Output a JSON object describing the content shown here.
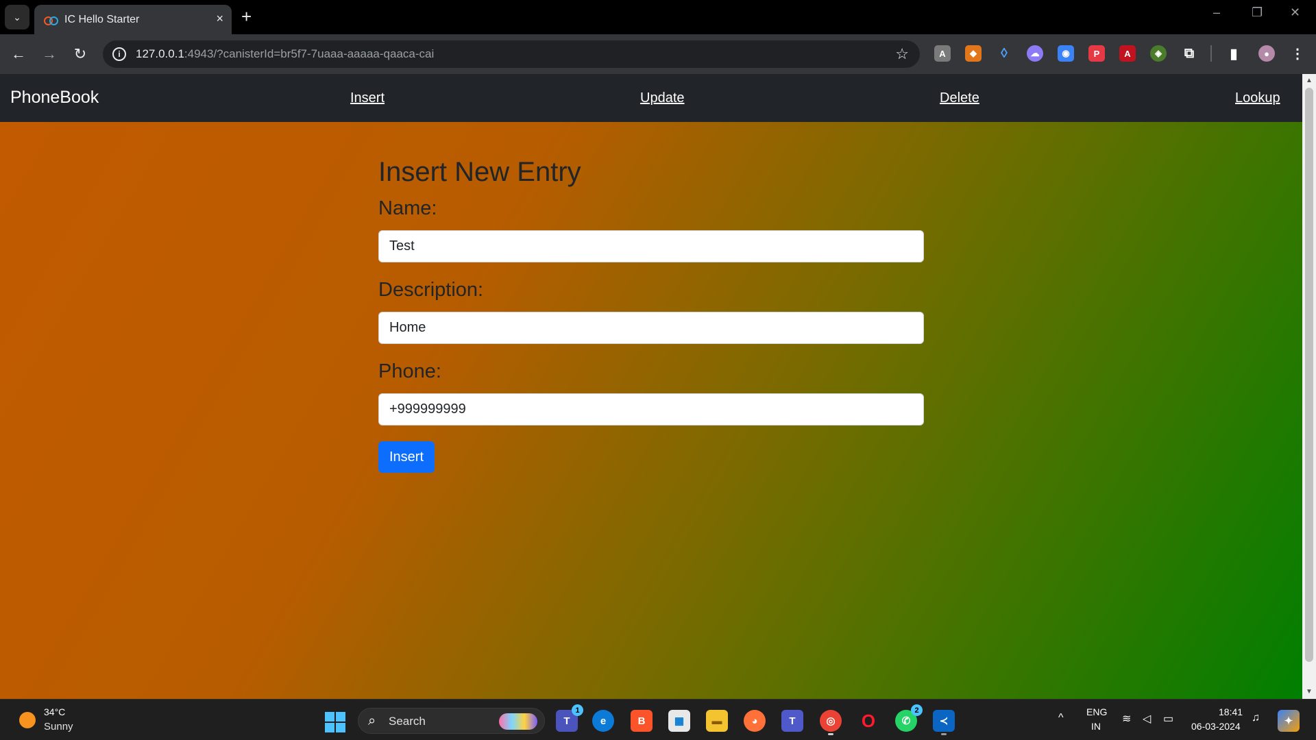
{
  "browser": {
    "tab_title": "IC Hello Starter",
    "tab_close": "×",
    "new_tab": "+",
    "url_host": "127.0.0.1",
    "url_rest": ":4943/?canisterId=br5f7-7uaaa-aaaaa-qaaca-cai",
    "window_controls": [
      "–",
      "❐",
      "✕"
    ]
  },
  "navbar": {
    "brand": "PhoneBook",
    "links": [
      "Insert",
      "Update",
      "Delete",
      "Lookup"
    ]
  },
  "form": {
    "title": "Insert New Entry",
    "name_label": "Name:",
    "name_value": "Test",
    "description_label": "Description:",
    "description_value": "Home",
    "phone_label": "Phone:",
    "phone_value": "+999999999",
    "submit_label": "Insert"
  },
  "taskbar": {
    "weather_temp": "34°C",
    "weather_condition": "Sunny",
    "search_label": "Search",
    "teams_badge": "1",
    "whatsapp_badge": "2",
    "language": "ENG",
    "region": "IN",
    "time": "18:41",
    "date": "06-03-2024"
  },
  "colors": {
    "navbar_bg": "#212529",
    "primary_button": "#0d6efd",
    "gradient_start": "#c25a00",
    "gradient_end": "#007f00"
  }
}
